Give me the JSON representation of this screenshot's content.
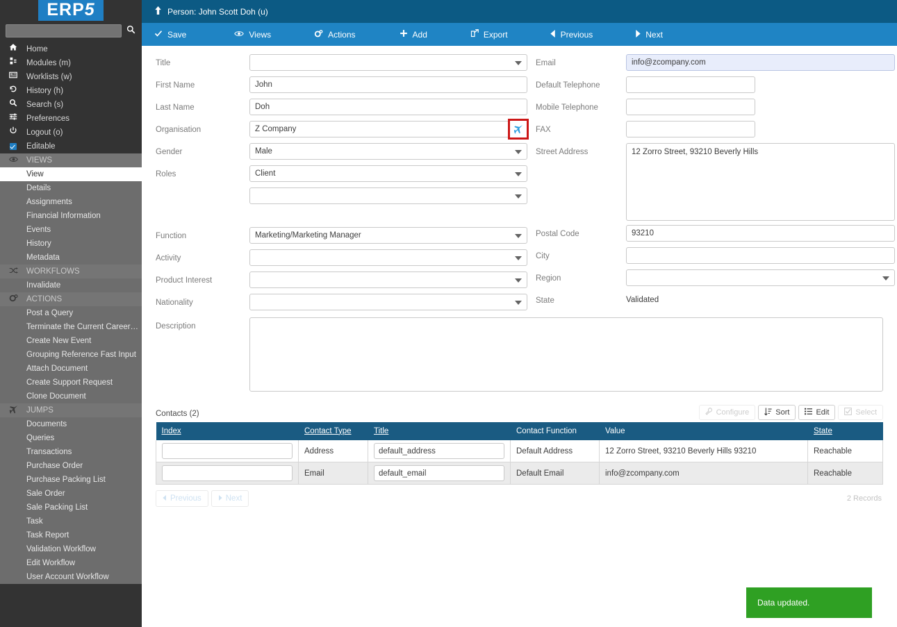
{
  "brand": {
    "logo_text": "ERP",
    "logo_suffix": "5",
    "accent": "#1f7fc4"
  },
  "sidebar": {
    "search_placeholder": "",
    "search_value": "",
    "search_icon": "search-icon",
    "top_items": [
      {
        "icon": "home-icon",
        "glyph": "⌂",
        "label": "Home"
      },
      {
        "icon": "modules-icon",
        "glyph": "⑂",
        "label": "Modules (m)"
      },
      {
        "icon": "worklists-icon",
        "glyph": "☰",
        "label": "Worklists (w)"
      },
      {
        "icon": "history-icon",
        "glyph": "↺",
        "label": "History (h)"
      },
      {
        "icon": "search-icon",
        "glyph": "⌕",
        "label": "Search (s)"
      },
      {
        "icon": "preferences-icon",
        "glyph": "≡",
        "label": "Preferences"
      },
      {
        "icon": "logout-icon",
        "glyph": "⏻",
        "label": "Logout (o)"
      },
      {
        "icon": "checkbox-checked-icon",
        "glyph": "",
        "label": "Editable"
      }
    ],
    "groups": [
      {
        "icon": "eye-icon",
        "glyph": "◉",
        "label": "VIEWS",
        "items": [
          {
            "label": "View",
            "active": true
          },
          {
            "label": "Details",
            "active": false
          },
          {
            "label": "Assignments",
            "active": false
          },
          {
            "label": "Financial Information",
            "active": false
          },
          {
            "label": "Events",
            "active": false
          },
          {
            "label": "History",
            "active": false
          },
          {
            "label": "Metadata",
            "active": false
          }
        ]
      },
      {
        "icon": "shuffle-icon",
        "glyph": "⇄",
        "label": "WORKFLOWS",
        "items": [
          {
            "label": "Invalidate",
            "active": false
          }
        ]
      },
      {
        "icon": "gear-icon",
        "glyph": "⚙",
        "label": "ACTIONS",
        "items": [
          {
            "label": "Post a Query",
            "active": false
          },
          {
            "label": "Terminate the Current Career…",
            "active": false
          },
          {
            "label": "Create New Event",
            "active": false
          },
          {
            "label": "Grouping Reference Fast Input",
            "active": false
          },
          {
            "label": "Attach Document",
            "active": false
          },
          {
            "label": "Create Support Request",
            "active": false
          },
          {
            "label": "Clone Document",
            "active": false
          }
        ]
      },
      {
        "icon": "airplane-icon",
        "glyph": "✈",
        "label": "JUMPS",
        "items": [
          {
            "label": "Documents",
            "active": false
          },
          {
            "label": "Queries",
            "active": false
          },
          {
            "label": "Transactions",
            "active": false
          },
          {
            "label": "Purchase Order",
            "active": false
          },
          {
            "label": "Purchase Packing List",
            "active": false
          },
          {
            "label": "Sale Order",
            "active": false
          },
          {
            "label": "Sale Packing List",
            "active": false
          },
          {
            "label": "Task",
            "active": false
          },
          {
            "label": "Task Report",
            "active": false
          },
          {
            "label": "Validation Workflow",
            "active": false
          },
          {
            "label": "Edit Workflow",
            "active": false
          },
          {
            "label": "User Account Workflow",
            "active": false
          }
        ]
      }
    ]
  },
  "header": {
    "up_icon": "arrow-up-icon",
    "title": "Person: John Scott Doh (u)"
  },
  "toolbar": {
    "items": [
      {
        "icon": "check-icon",
        "glyph": "✔",
        "label": "Save"
      },
      {
        "icon": "eye-icon",
        "glyph": "◉",
        "label": "Views"
      },
      {
        "icon": "gear-icon",
        "glyph": "⚙",
        "label": "Actions"
      },
      {
        "icon": "plus-icon",
        "glyph": "✚",
        "label": "Add"
      },
      {
        "icon": "export-icon",
        "glyph": "↗",
        "label": "Export"
      },
      {
        "icon": "arrow-left-icon",
        "glyph": "◂",
        "label": "Previous"
      },
      {
        "icon": "arrow-right-icon",
        "glyph": "▸",
        "label": "Next"
      }
    ]
  },
  "form": {
    "left": {
      "title": {
        "label": "Title",
        "value": "",
        "type": "select"
      },
      "first_name": {
        "label": "First Name",
        "value": "John",
        "type": "text"
      },
      "last_name": {
        "label": "Last Name",
        "value": "Doh",
        "type": "text"
      },
      "organisation": {
        "label": "Organisation",
        "value": "Z Company",
        "type": "text",
        "jump_icon": "airplane-icon",
        "highlighted": true
      },
      "gender": {
        "label": "Gender",
        "value": "Male",
        "type": "select"
      },
      "roles": {
        "label": "Roles",
        "value": "Client",
        "value2": "",
        "type": "select"
      },
      "function": {
        "label": "Function",
        "value": "Marketing/Marketing Manager",
        "type": "select"
      },
      "activity": {
        "label": "Activity",
        "value": "",
        "type": "select"
      },
      "product_interest": {
        "label": "Product Interest",
        "value": "",
        "type": "select"
      },
      "nationality": {
        "label": "Nationality",
        "value": "",
        "type": "select"
      }
    },
    "right": {
      "email": {
        "label": "Email",
        "value": "info@zcompany.com",
        "type": "text",
        "focused": true
      },
      "default_telephone": {
        "label": "Default Telephone",
        "value": "",
        "type": "text",
        "small": true
      },
      "mobile_telephone": {
        "label": "Mobile Telephone",
        "value": "",
        "type": "text",
        "small": true
      },
      "fax": {
        "label": "FAX",
        "value": "",
        "type": "text",
        "small": true
      },
      "street_address": {
        "label": "Street Address",
        "value": "12 Zorro Street, 93210 Beverly Hills",
        "type": "textarea"
      },
      "postal_code": {
        "label": "Postal Code",
        "value": "93210",
        "type": "text"
      },
      "city": {
        "label": "City",
        "value": "",
        "type": "text"
      },
      "region": {
        "label": "Region",
        "value": "",
        "type": "select"
      },
      "state": {
        "label": "State",
        "value": "Validated",
        "type": "static"
      }
    },
    "description": {
      "label": "Description",
      "value": ""
    }
  },
  "listbox": {
    "title": "Contacts (2)",
    "tools": [
      {
        "icon": "wrench-icon",
        "glyph": "⚒",
        "label": "Configure",
        "disabled": true
      },
      {
        "icon": "sort-icon",
        "glyph": "⇵",
        "label": "Sort",
        "disabled": false
      },
      {
        "icon": "edit-list-icon",
        "glyph": "☰",
        "label": "Edit",
        "disabled": false
      },
      {
        "icon": "select-checkbox-icon",
        "glyph": "☑",
        "label": "Select",
        "disabled": true
      }
    ],
    "columns": [
      {
        "label": "Index",
        "sortable": true
      },
      {
        "label": "Contact Type",
        "sortable": true
      },
      {
        "label": "Title",
        "sortable": true
      },
      {
        "label": "Contact Function",
        "sortable": false
      },
      {
        "label": "Value",
        "sortable": false
      },
      {
        "label": "State",
        "sortable": true
      }
    ],
    "rows": [
      {
        "index": "",
        "contact_type": "Address",
        "title": "default_address",
        "contact_function": "Default Address",
        "value": "12 Zorro Street, 93210 Beverly Hills 93210",
        "state": "Reachable"
      },
      {
        "index": "",
        "contact_type": "Email",
        "title": "default_email",
        "contact_function": "Default Email",
        "value": "info@zcompany.com",
        "state": "Reachable"
      }
    ],
    "pager": {
      "previous": "Previous",
      "next": "Next",
      "record_count": "2 Records"
    }
  },
  "toast": {
    "message": "Data updated.",
    "color": "#2fa023"
  }
}
